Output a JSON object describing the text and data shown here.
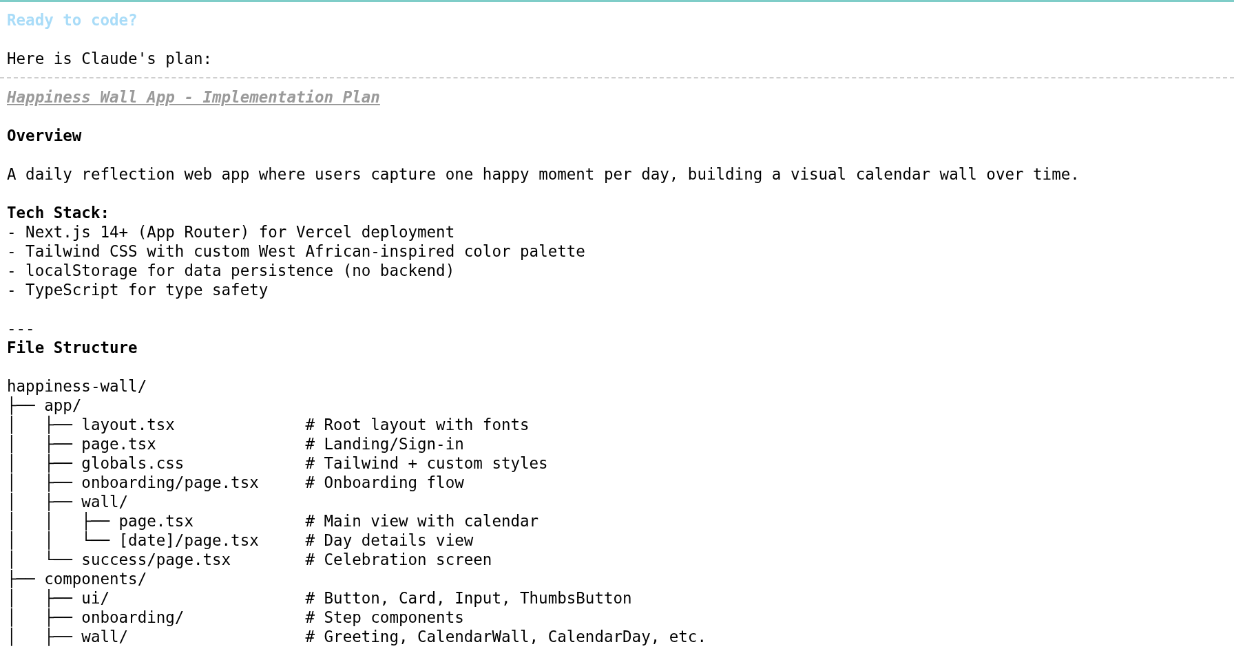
{
  "prompt": {
    "title": "Ready to code?",
    "intro": "Here is Claude's plan:"
  },
  "plan": {
    "title": "Happiness Wall App - Implementation Plan",
    "lines": [
      {
        "kind": "blank"
      },
      {
        "kind": "heading",
        "text": "Overview"
      },
      {
        "kind": "blank"
      },
      {
        "kind": "text",
        "text": "A daily reflection web app where users capture one happy moment per day, building a visual calendar wall over time."
      },
      {
        "kind": "blank"
      },
      {
        "kind": "heading",
        "text": "Tech Stack:"
      },
      {
        "kind": "text",
        "text": "- Next.js 14+ (App Router) for Vercel deployment"
      },
      {
        "kind": "text",
        "text": "- Tailwind CSS with custom West African-inspired color palette"
      },
      {
        "kind": "text",
        "text": "- localStorage for data persistence (no backend)"
      },
      {
        "kind": "text",
        "text": "- TypeScript for type safety"
      },
      {
        "kind": "blank"
      },
      {
        "kind": "text",
        "text": "---"
      },
      {
        "kind": "heading",
        "text": "File Structure"
      },
      {
        "kind": "blank"
      },
      {
        "kind": "text",
        "text": "happiness-wall/"
      },
      {
        "kind": "tree",
        "path": "├── app/"
      },
      {
        "kind": "tree",
        "path": "│   ├── layout.tsx",
        "comment": "# Root layout with fonts"
      },
      {
        "kind": "tree",
        "path": "│   ├── page.tsx",
        "comment": "# Landing/Sign-in"
      },
      {
        "kind": "tree",
        "path": "│   ├── globals.css",
        "comment": "# Tailwind + custom styles"
      },
      {
        "kind": "tree",
        "path": "│   ├── onboarding/page.tsx",
        "comment": "# Onboarding flow"
      },
      {
        "kind": "tree",
        "path": "│   ├── wall/"
      },
      {
        "kind": "tree",
        "path": "│   │   ├── page.tsx",
        "comment": "# Main view with calendar"
      },
      {
        "kind": "tree",
        "path": "│   │   └── [date]/page.tsx",
        "comment": "# Day details view"
      },
      {
        "kind": "tree",
        "path": "│   └── success/page.tsx",
        "comment": "# Celebration screen"
      },
      {
        "kind": "tree",
        "path": "├── components/"
      },
      {
        "kind": "tree",
        "path": "│   ├── ui/",
        "comment": "# Button, Card, Input, ThumbsButton"
      },
      {
        "kind": "tree",
        "path": "│   ├── onboarding/",
        "comment": "# Step components"
      },
      {
        "kind": "tree",
        "path": "│   ├── wall/",
        "comment": "# Greeting, CalendarWall, CalendarDay, etc."
      }
    ]
  }
}
